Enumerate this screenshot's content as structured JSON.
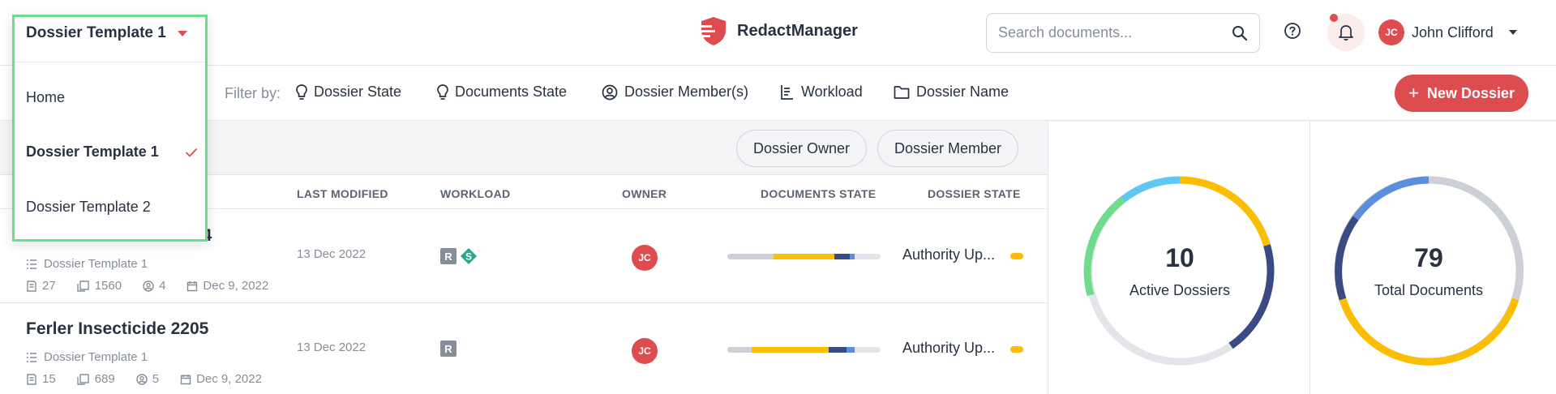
{
  "header": {
    "template_selector": "Dossier Template 1",
    "logo_text": "RedactManager",
    "search_placeholder": "Search documents...",
    "user_initials": "JC",
    "user_name": "John Clifford"
  },
  "dropdown": {
    "items": [
      {
        "label": "Home",
        "selected": false
      },
      {
        "label": "Dossier Template 1",
        "selected": true
      },
      {
        "label": "Dossier Template 2",
        "selected": false
      }
    ]
  },
  "filterbar": {
    "label": "Filter by:",
    "filters": [
      "Dossier State",
      "Documents State",
      "Dossier Member(s)",
      "Workload",
      "Dossier Name"
    ],
    "new_button": "New Dossier"
  },
  "quick_filters": [
    "Dossier Owner",
    "Dossier Member"
  ],
  "table": {
    "columns": [
      "LAST MODIFIED",
      "WORKLOAD",
      "OWNER",
      "DOCUMENTS STATE",
      "DOSSIER STATE"
    ],
    "rows": [
      {
        "name": "04",
        "template": "Dossier Template 1",
        "files": "27",
        "pages": "1560",
        "members": "4",
        "date": "Dec 9, 2022",
        "modified": "13 Dec 2022",
        "workload": [
          "R",
          "S"
        ],
        "owner": "JC",
        "doc_state": [
          0.3,
          0.4,
          0.1,
          0.03
        ],
        "state": "Authority Up..."
      },
      {
        "name": "Ferler Insecticide 2205",
        "template": "Dossier Template 1",
        "files": "15",
        "pages": "689",
        "members": "5",
        "date": "Dec 9, 2022",
        "modified": "13 Dec 2022",
        "workload": [
          "R"
        ],
        "owner": "JC",
        "doc_state": [
          0.16,
          0.5,
          0.12,
          0.05
        ],
        "state": "Authority Up..."
      }
    ]
  },
  "stats": {
    "active_count": "10",
    "active_label": "Active Dossiers",
    "docs_count": "79",
    "docs_label": "Total Documents"
  },
  "colors": {
    "accent": "#dd4d50",
    "yellow": "#fdbd00",
    "navy": "#3a4a82",
    "blue": "#5b8fdd",
    "grey": "#cdd0d6",
    "green": "#6fdc8c",
    "cyan": "#5fc8f2"
  }
}
